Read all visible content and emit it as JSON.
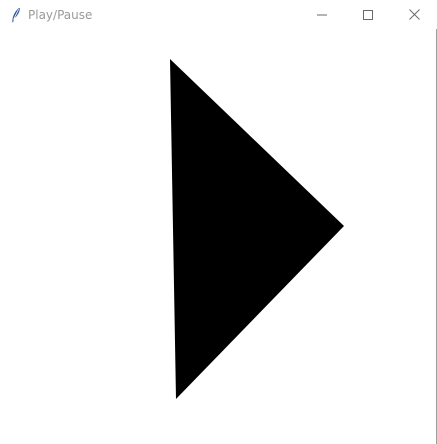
{
  "window": {
    "title": "Play/Pause",
    "app_icon": "feather-icon",
    "controls": {
      "minimize_icon": "minimize-icon",
      "maximize_icon": "maximize-icon",
      "close_icon": "close-icon"
    }
  },
  "canvas": {
    "background": "#ffffff",
    "shape": {
      "icon": "play-icon",
      "fill": "#000000"
    }
  }
}
